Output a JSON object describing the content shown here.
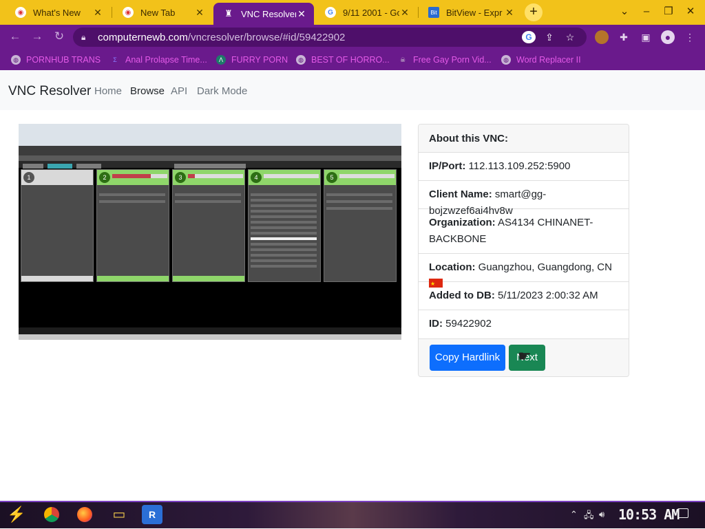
{
  "browser": {
    "tabs": [
      {
        "title": "What's New",
        "icon": "chrome-icon",
        "active": false
      },
      {
        "title": "New Tab",
        "icon": "chrome-icon",
        "active": false
      },
      {
        "title": "VNC Resolver",
        "icon": "spy-icon",
        "active": true
      },
      {
        "title": "9/11 2001 - Go",
        "icon": "google-icon",
        "active": false
      },
      {
        "title": "BitView - Expr",
        "icon": "bitview-icon",
        "active": false
      }
    ],
    "new_tab_symbol": "+",
    "url_domain": "computernewb.com",
    "url_path": "/vncresolver/browse/#id/59422902",
    "bookmarks": [
      {
        "label": "PORNHUB TRANS"
      },
      {
        "label": "Anal Prolapse Time..."
      },
      {
        "label": "FURRY PORN"
      },
      {
        "label": "BEST OF HORRO..."
      },
      {
        "label": "Free Gay Porn Vid..."
      },
      {
        "label": "Word Replacer II"
      }
    ],
    "accent_color": "#6a1a8c",
    "tab_strip_color": "#f2c21a"
  },
  "site": {
    "brand": "VNC Resolver",
    "nav": [
      {
        "label": "Home",
        "active": false
      },
      {
        "label": "Browse",
        "active": true
      },
      {
        "label": "API",
        "active": false
      },
      {
        "label": "Dark Mode",
        "active": false
      }
    ]
  },
  "vnc": {
    "header": "About this VNC:",
    "ip_label": "IP/Port:",
    "ip_value": "112.113.109.252:5900",
    "client_label": "Client Name:",
    "client_value": "smart@gg-bojzwzef6ai4hv8w",
    "org_label": "Organization:",
    "org_value": "AS4134 CHINANET-BACKBONE",
    "location_label": "Location:",
    "location_value": "Guangzhou, Guangdong, CN",
    "location_flag": "china-flag-icon",
    "added_label": "Added to DB:",
    "added_value": "5/11/2023 2:00:32 AM",
    "id_label": "ID:",
    "id_value": "59422902",
    "copy_button": "Copy Hardlink",
    "next_button": "Next"
  },
  "taskbar": {
    "clock": "10:53 AM"
  }
}
